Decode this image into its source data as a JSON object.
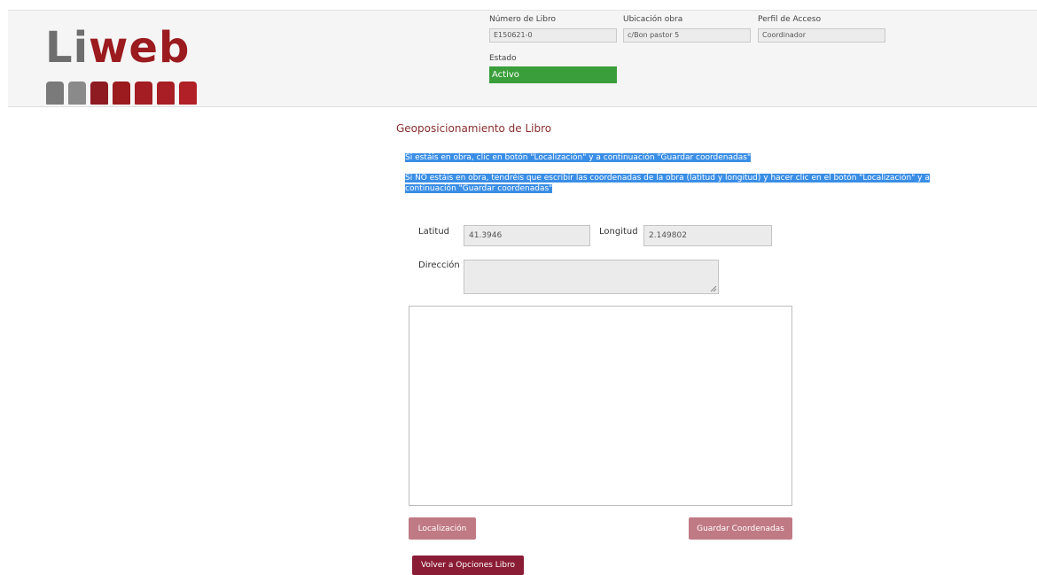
{
  "logo": {
    "part1": "Li",
    "part2": "web"
  },
  "header": {
    "numero_libro": {
      "label": "Número de Libro",
      "value": "E150621-0"
    },
    "ubicacion": {
      "label": "Ubicación obra",
      "value": "c/Bon pastor 5"
    },
    "perfil": {
      "label": "Perfil de Acceso",
      "value": "Coordinador"
    },
    "estado": {
      "label": "Estado",
      "value": "Activo"
    }
  },
  "section": {
    "title": "Geoposicionamiento de Libro",
    "instruction_1": "Si estáis en obra, clic en botón \"Localización\" y a continuación \"Guardar coordenadas\"",
    "instruction_2a": "Si NO estáis en obra, tendréis que escribir las coordenadas de la obra (latitud y longitud) y hacer clic en el botón \"Localización\" y a",
    "instruction_2b": "continuación \"Guardar coordenadas\""
  },
  "form": {
    "latitud_label": "Latitud",
    "latitud_value": "41.3946",
    "longitud_label": "Longitud",
    "longitud_value": "2.149802",
    "direccion_label": "Dirección",
    "direccion_value": ""
  },
  "buttons": {
    "localizacion": "Localización",
    "guardar": "Guardar Coordenadas",
    "volver": "Volver a Opciones Libro"
  },
  "colors": {
    "brand_red": "#9b1b1f",
    "estado_green": "#3a9f3a",
    "highlight_blue": "#3a8ee6",
    "button_light": "#c07a84",
    "button_dark": "#8a1c35"
  }
}
